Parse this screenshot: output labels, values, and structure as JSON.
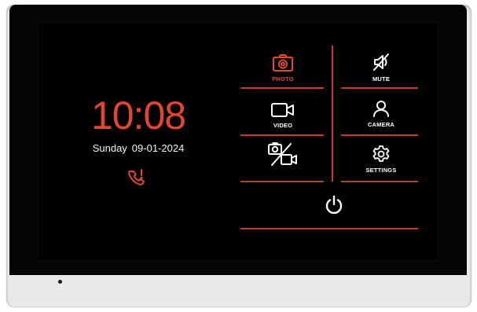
{
  "clock": {
    "time": "10:08",
    "day": "Sunday",
    "date": "09-01-2024"
  },
  "status": {
    "missed_call_icon": "missed-call-icon"
  },
  "menu": {
    "photo": {
      "label": "PHOTO",
      "icon": "camera-photo-icon",
      "active": true
    },
    "mute": {
      "label": "MUTE",
      "icon": "speaker-muted-icon"
    },
    "video": {
      "label": "VIDEO",
      "icon": "video-camera-icon"
    },
    "camera": {
      "label": "CAMERA",
      "icon": "person-icon"
    },
    "photo_video": {
      "label": "",
      "icon": "photo-video-toggle-icon"
    },
    "settings": {
      "label": "SETTINGS",
      "icon": "gear-icon"
    },
    "power": {
      "icon": "power-icon"
    }
  },
  "colors": {
    "accent": "#e2472e",
    "divider": "#c8392b",
    "screen": "#000000",
    "frame": "#e9e9ea",
    "text": "#ffffff"
  }
}
